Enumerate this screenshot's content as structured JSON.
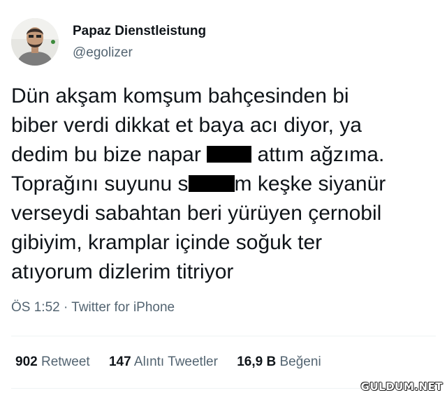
{
  "author": {
    "name": "Papaz Dienstleistung",
    "handle": "@egolizer"
  },
  "tweet": {
    "lines": [
      "Dün akşam komşum bahçesinden bi",
      "biber verdi dikkat et baya acı diyor, ya",
      "dedim bu bize napar",
      "attım ağzıma.",
      "Toprağını suyunu s",
      "m keşke siyanür",
      "verseydi sabahtan beri yürüyen çernobil",
      "gibiyim, kramplar içinde soğuk ter",
      "atıyorum dizlerim titriyor"
    ]
  },
  "meta": {
    "time": "ÖS 1:52",
    "separator": "·",
    "source": "Twitter for iPhone"
  },
  "stats": {
    "retweets_count": "902",
    "retweets_label": "Retweet",
    "quotes_count": "147",
    "quotes_label": "Alıntı Tweetler",
    "likes_count": "16,9 B",
    "likes_label": "Beğeni"
  },
  "watermark": "GULDUM.NET",
  "icons": {
    "avatar": "profile-photo-avatar"
  },
  "colors": {
    "text": "#0f1419",
    "secondary": "#536471",
    "divider": "#eff3f4"
  }
}
